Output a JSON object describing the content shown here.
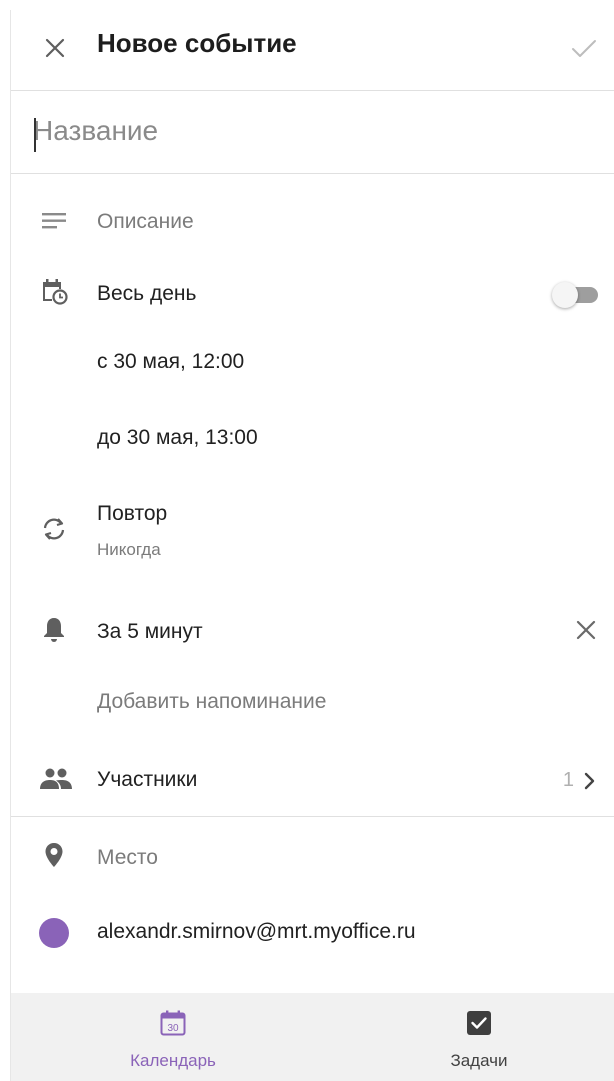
{
  "header": {
    "title": "Новое событие",
    "close_icon": "close-icon",
    "confirm_icon": "check-icon"
  },
  "title_field": {
    "placeholder": "Название",
    "value": ""
  },
  "description": {
    "icon": "description-icon",
    "label": "Описание"
  },
  "all_day": {
    "icon": "calendar-clock-icon",
    "label": "Весь день",
    "enabled": false
  },
  "start": {
    "label": "с 30 мая, 12:00"
  },
  "end": {
    "label": "до 30 мая, 13:00"
  },
  "repeat": {
    "icon": "repeat-icon",
    "label": "Повтор",
    "value": "Никогда"
  },
  "reminder": {
    "icon": "bell-icon",
    "label": "За 5 минут",
    "remove_icon": "close-icon",
    "add_label": "Добавить напоминание"
  },
  "participants": {
    "icon": "people-icon",
    "label": "Участники",
    "count": "1",
    "chevron_icon": "chevron-right-icon"
  },
  "place": {
    "icon": "location-pin-icon",
    "label": "Место"
  },
  "calendar_account": {
    "color": "#8a63b8",
    "label": "alexandr.smirnov@mrt.myoffice.ru"
  },
  "bottom_nav": {
    "items": [
      {
        "label": "Календарь",
        "icon": "calendar-icon",
        "icon_text": "30",
        "active": true,
        "color": "#8a63b8"
      },
      {
        "label": "Задачи",
        "icon": "checkbox-icon",
        "active": false,
        "color": "#424242"
      }
    ]
  },
  "colors": {
    "accent": "#8a63b8",
    "divider": "#e0e0e0",
    "nav_background": "#f1f1f1"
  }
}
